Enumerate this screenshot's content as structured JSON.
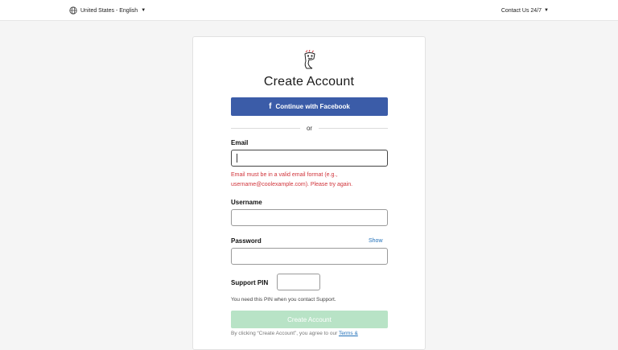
{
  "topbar": {
    "locale_label": "United States - English",
    "contact_label": "Contact Us 24/7",
    "icons": {
      "locale": "globe-icon",
      "dropdown": "caret-down-icon"
    }
  },
  "card": {
    "title": "Create Account",
    "facebook_button_label": "Continue with Facebook",
    "divider_label": "or",
    "email": {
      "label": "Email",
      "value": "",
      "error": "Email must be in a valid email format (e.g., username@coolexample.com). Please try again."
    },
    "username": {
      "label": "Username",
      "value": ""
    },
    "password": {
      "label": "Password",
      "value": "",
      "show_label": "Show"
    },
    "support_pin": {
      "label": "Support PIN",
      "value": "",
      "help": "You need this PIN when you contact Support."
    },
    "create_button_label": "Create Account",
    "terms_prefix": "By clicking “Create Account”, you agree to our",
    "terms_link": "Terms &"
  },
  "colors": {
    "facebook": "#3b5ca8",
    "error": "#d0333a",
    "create_button_disabled": "#b8e3c6",
    "link": "#1f6fb8"
  }
}
